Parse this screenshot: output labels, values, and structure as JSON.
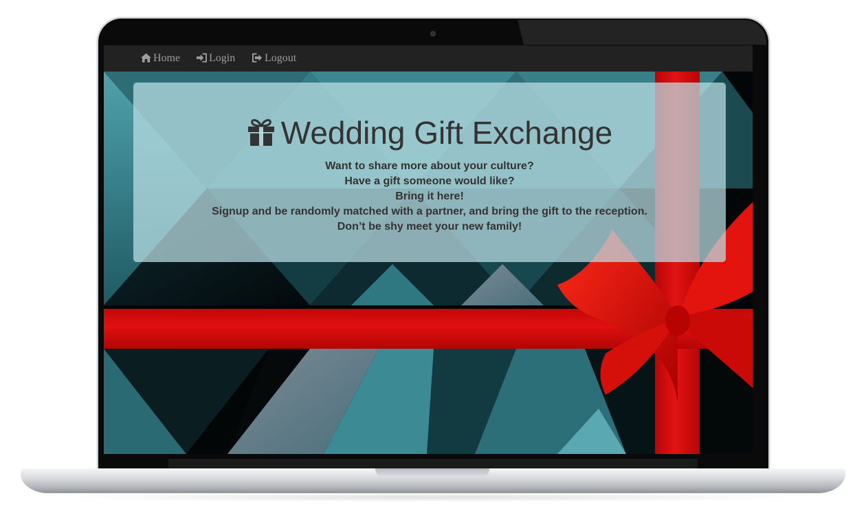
{
  "nav": {
    "items": [
      {
        "label": "Home",
        "icon": "home-icon"
      },
      {
        "label": "Login",
        "icon": "sign-in-icon"
      },
      {
        "label": "Logout",
        "icon": "sign-out-icon"
      }
    ]
  },
  "hero": {
    "title": "Wedding Gift Exchange",
    "title_icon": "gift-icon",
    "lines": [
      "Want to share more about your culture?",
      "Have a gift someone would like?",
      "Bring it here!",
      "Signup and be randomly matched with a partner, and bring the gift to the reception.",
      "Don’t be shy meet your new family!"
    ]
  },
  "colors": {
    "navbar": "#222222",
    "nav_text": "#9d9d9d",
    "ribbon": "#d90f0f",
    "teal": "#3f8e98",
    "jumbotron": "#bce1e6"
  }
}
